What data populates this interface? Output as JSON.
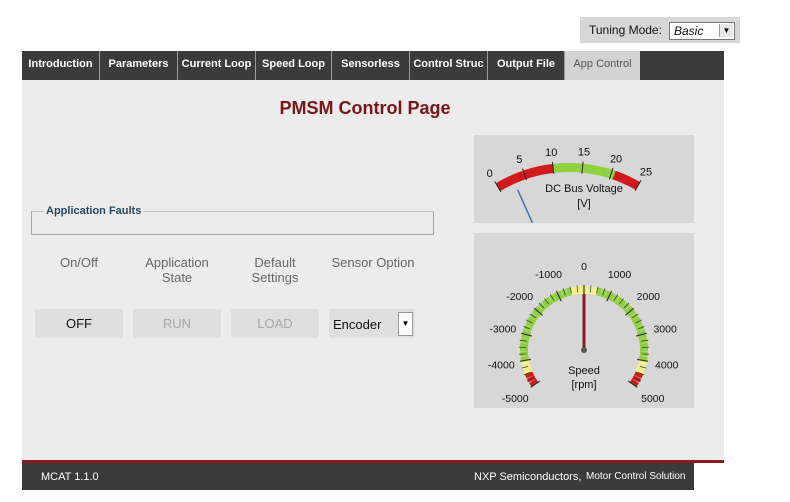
{
  "tuning": {
    "label": "Tuning Mode:",
    "value": "Basic"
  },
  "tabs": [
    {
      "label": "Introduction"
    },
    {
      "label": "Parameters"
    },
    {
      "label": "Current Loop"
    },
    {
      "label": "Speed Loop"
    },
    {
      "label": "Sensorless"
    },
    {
      "label": "Control Struc"
    },
    {
      "label": "Output File"
    },
    {
      "label": "App Control",
      "active": true
    }
  ],
  "page": {
    "title": "PMSM Control Page"
  },
  "faults": {
    "legend": "Application Faults"
  },
  "controls": {
    "onoff_label": "On/Off",
    "state_label_1": "Application",
    "state_label_2": "State",
    "default_label_1": "Default",
    "default_label_2": "Settings",
    "sensor_label": "Sensor Option",
    "off_button": "OFF",
    "run_button": "RUN",
    "load_button": "LOAD",
    "sensor_value": "Encoder"
  },
  "voltage_gauge": {
    "title": "DC Bus Voltage",
    "unit": "[V]",
    "ticks": [
      "0",
      "5",
      "10",
      "15",
      "20",
      "25"
    ],
    "value": 0,
    "colors": {
      "red": "#d11b1b",
      "green": "#8fd13f"
    }
  },
  "speed_gauge": {
    "title": "Speed",
    "unit": "[rpm]",
    "ticks": [
      "-5000",
      "-4000",
      "-3000",
      "-2000",
      "-1000",
      "0",
      "1000",
      "2000",
      "3000",
      "4000",
      "5000"
    ],
    "value": 0,
    "colors": {
      "red": "#d11b1b",
      "yellow": "#f5f08a",
      "green": "#8fd13f",
      "needle": "#8b1a1e"
    }
  },
  "footer": {
    "version": "MCAT 1.1.0",
    "vendor": "NXP Semiconductors,",
    "tagline": "Motor Control Solution"
  }
}
